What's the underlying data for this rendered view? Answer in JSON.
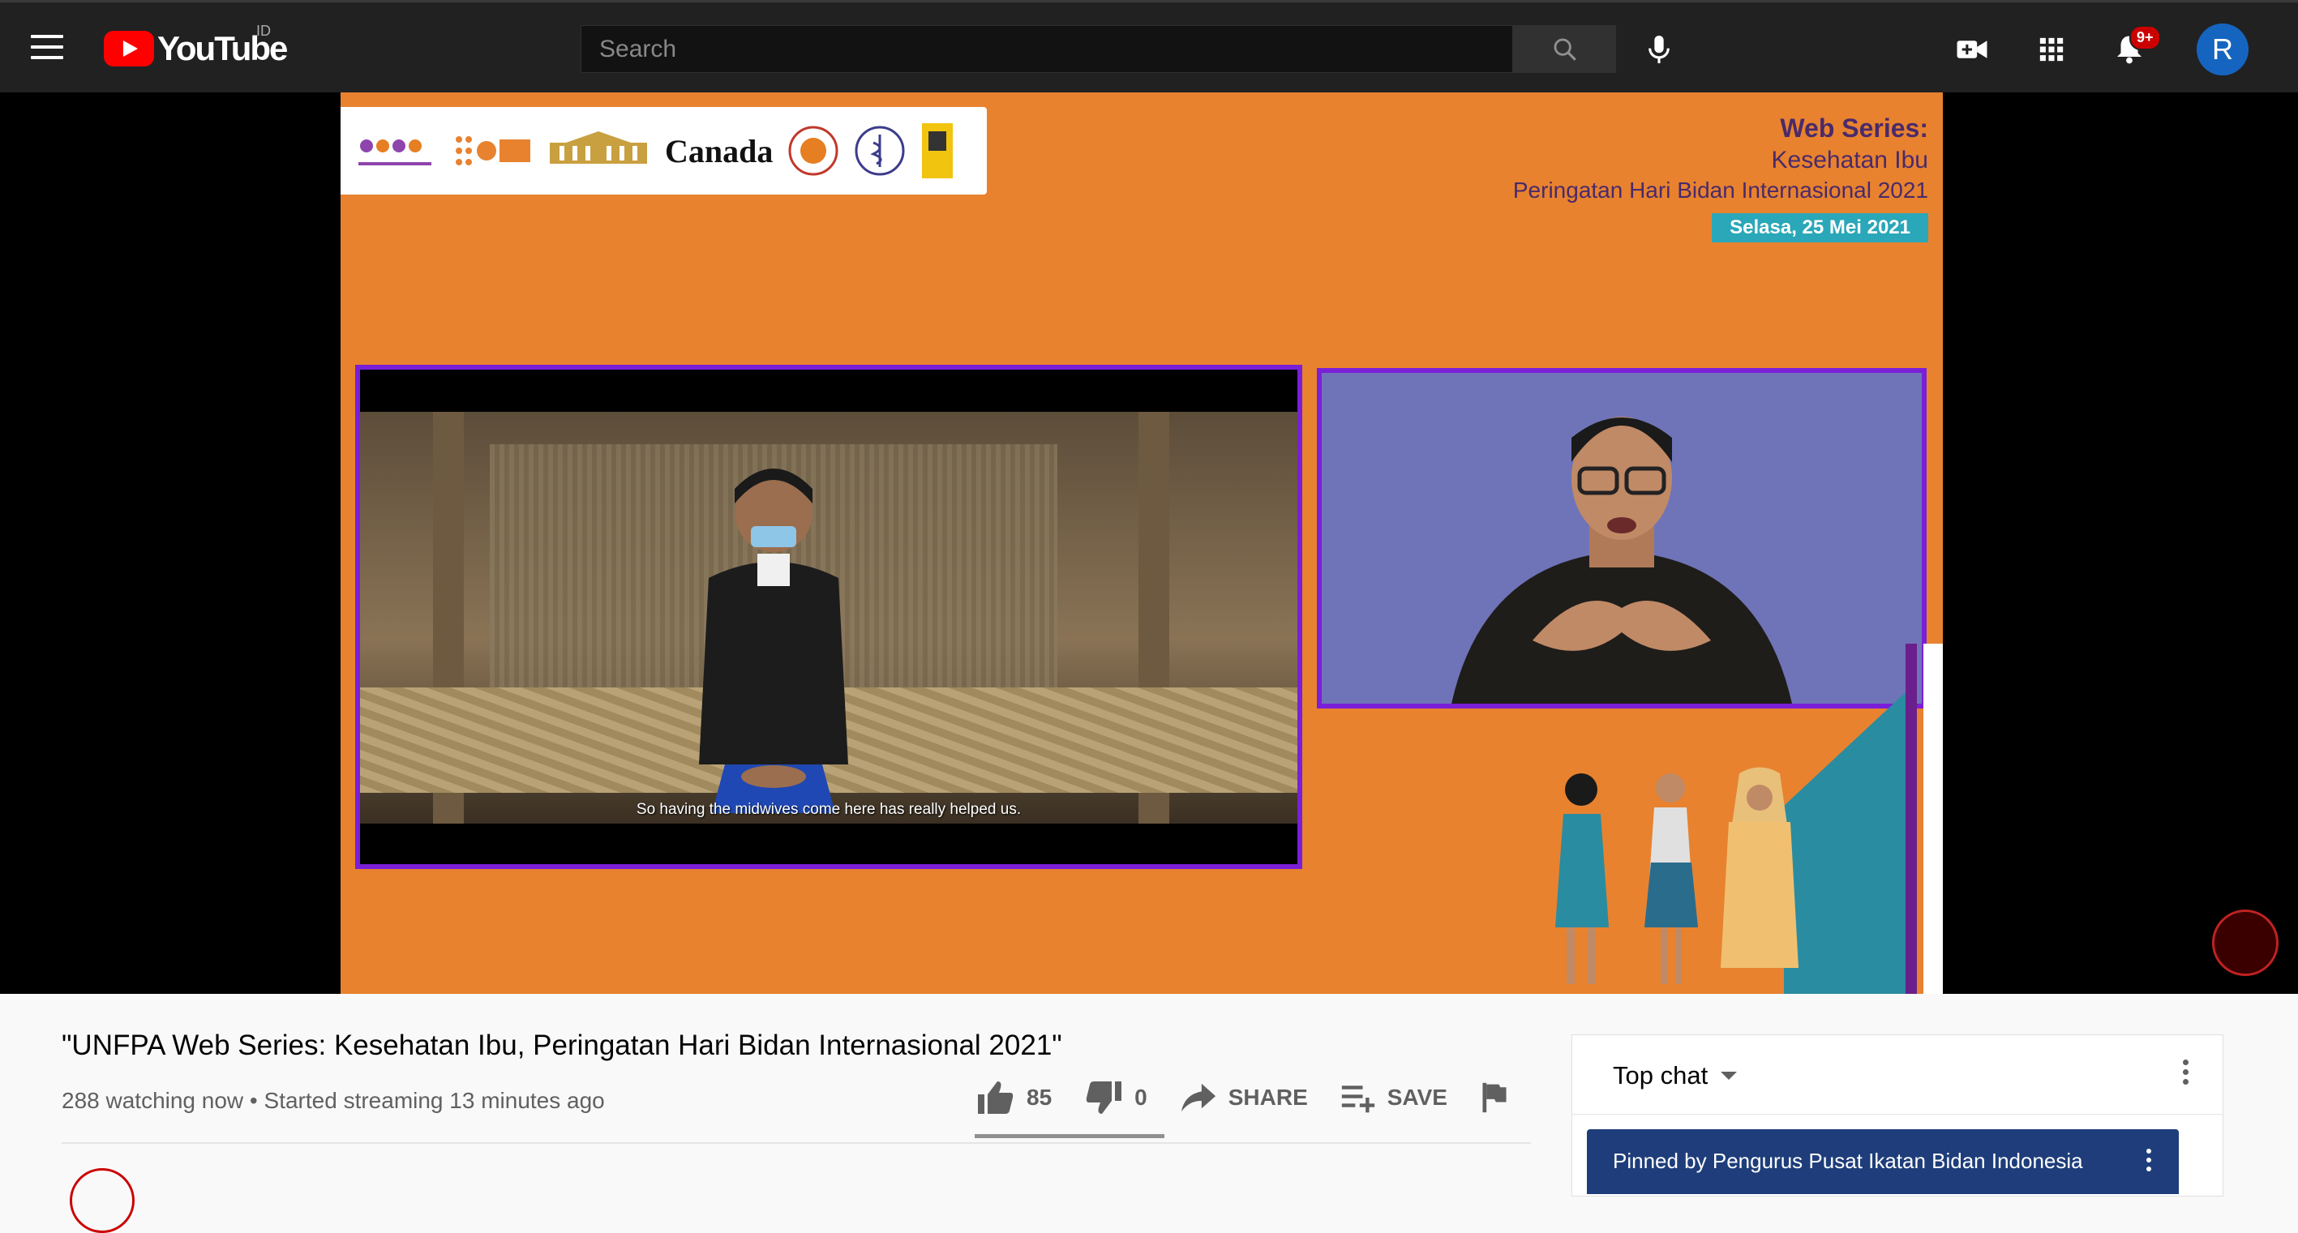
{
  "header": {
    "logo_text": "YouTube",
    "region": "ID",
    "search_placeholder": "Search",
    "notification_count": "9+",
    "avatar_letter": "R"
  },
  "video": {
    "logos_text": "Canada",
    "series_title": "Web Series:",
    "series_sub1": "Kesehatan Ibu",
    "series_sub2": "Peringatan Hari Bidan Internasional 2021",
    "date_label": "Selasa, 25 Mei 2021",
    "subtitle": "So having the midwives come here has really helped us."
  },
  "info": {
    "title": "\"UNFPA Web Series: Kesehatan Ibu, Peringatan Hari Bidan Internasional 2021\"",
    "meta": "288 watching now • Started streaming 13 minutes ago",
    "likes": "85",
    "dislikes": "0",
    "share_label": "SHARE",
    "save_label": "SAVE"
  },
  "chat": {
    "mode_label": "Top chat",
    "pinned_text": "Pinned by Pengurus Pusat Ikatan Bidan Indonesia"
  },
  "colors": {
    "brand_red": "#ff0000",
    "video_bg": "#e8822f",
    "frame_purple": "#7a1fd8",
    "pinned_bg": "#1e3d7a"
  }
}
